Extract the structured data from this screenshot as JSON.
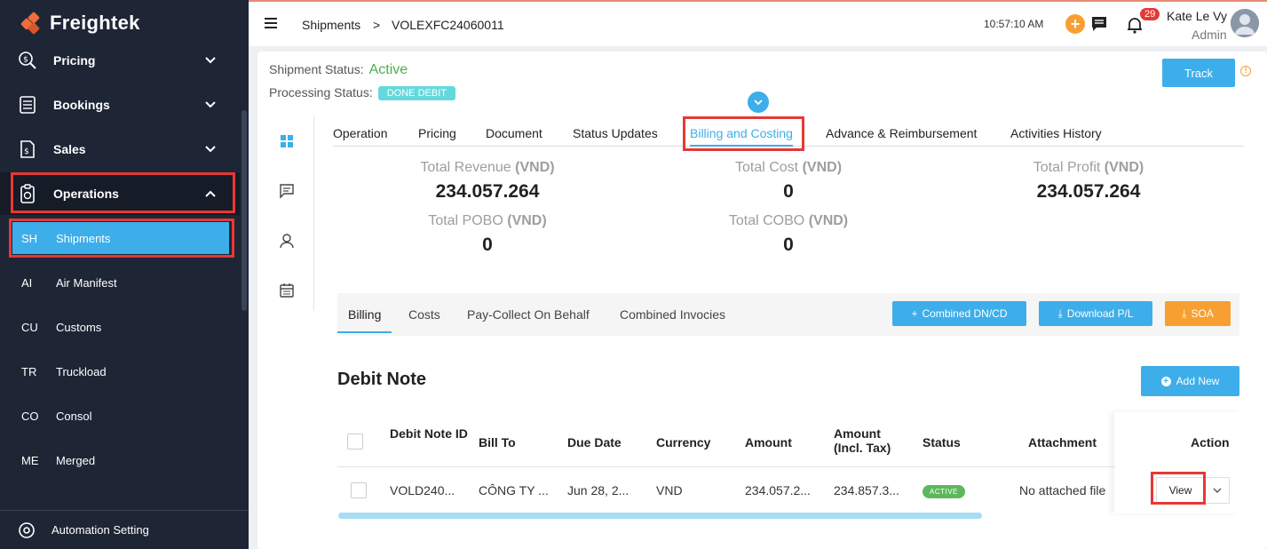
{
  "app": {
    "name": "Freightek"
  },
  "sidebar": {
    "groups": [
      {
        "label": "Pricing",
        "icon": "pricing-icon"
      },
      {
        "label": "Bookings",
        "icon": "bookings-icon"
      },
      {
        "label": "Sales",
        "icon": "sales-icon"
      },
      {
        "label": "Operations",
        "icon": "operations-icon"
      }
    ],
    "items": [
      {
        "code": "SH",
        "label": "Shipments"
      },
      {
        "code": "AI",
        "label": "Air Manifest"
      },
      {
        "code": "CU",
        "label": "Customs"
      },
      {
        "code": "TR",
        "label": "Truckload"
      },
      {
        "code": "CO",
        "label": "Consol"
      },
      {
        "code": "ME",
        "label": "Merged"
      }
    ],
    "footer": {
      "label": "Automation Setting"
    }
  },
  "topbar": {
    "breadcrumb_root": "Shipments",
    "breadcrumb_sep": ">",
    "breadcrumb_current": "VOLEXFC24060011",
    "time": "10:57:10 AM",
    "notification_count": "29",
    "user_name": "Kate Le Vy",
    "user_role": "Admin"
  },
  "shipment": {
    "status_label": "Shipment Status:",
    "status_value": "Active",
    "processing_label": "Processing Status:",
    "processing_value": "DONE DEBIT",
    "track_label": "Track"
  },
  "tabs": [
    "Operation",
    "Pricing",
    "Document",
    "Status Updates",
    "Billing and Costing",
    "Advance & Reimbursement",
    "Activities History"
  ],
  "stats": {
    "revenue": {
      "label": "Total Revenue",
      "unit": "(VND)",
      "value": "234.057.264"
    },
    "cost": {
      "label": "Total Cost",
      "unit": "(VND)",
      "value": "0"
    },
    "profit": {
      "label": "Total Profit",
      "unit": "(VND)",
      "value": "234.057.264"
    },
    "pobo": {
      "label": "Total POBO",
      "unit": "(VND)",
      "value": "0"
    },
    "cobo": {
      "label": "Total COBO",
      "unit": "(VND)",
      "value": "0"
    }
  },
  "subtabs": [
    "Billing",
    "Costs",
    "Pay-Collect On Behalf",
    "Combined Invocies"
  ],
  "actions": {
    "combined": "Combined DN/CD",
    "download": "Download P/L",
    "soa": "SOA",
    "add_new": "Add New"
  },
  "debit_note": {
    "title": "Debit Note",
    "columns": [
      "Debit Note ID",
      "Bill To",
      "Due Date",
      "Currency",
      "Amount",
      "Amount (Incl. Tax)",
      "Status",
      "Attachment",
      "Action"
    ],
    "rows": [
      {
        "id": "VOLD240...",
        "bill_to": "CÔNG TY ...",
        "due_date": "Jun 28, 2...",
        "currency": "VND",
        "amount": "234.057.2...",
        "amount_tax": "234.857.3...",
        "status": "ACTIVE",
        "attachment": "No attached file",
        "action": "View"
      }
    ]
  },
  "colors": {
    "sidebar": "#1e2535",
    "accent": "#3daee9",
    "orange": "#f7a031",
    "highlight": "#e53935",
    "success": "#4caf50"
  }
}
